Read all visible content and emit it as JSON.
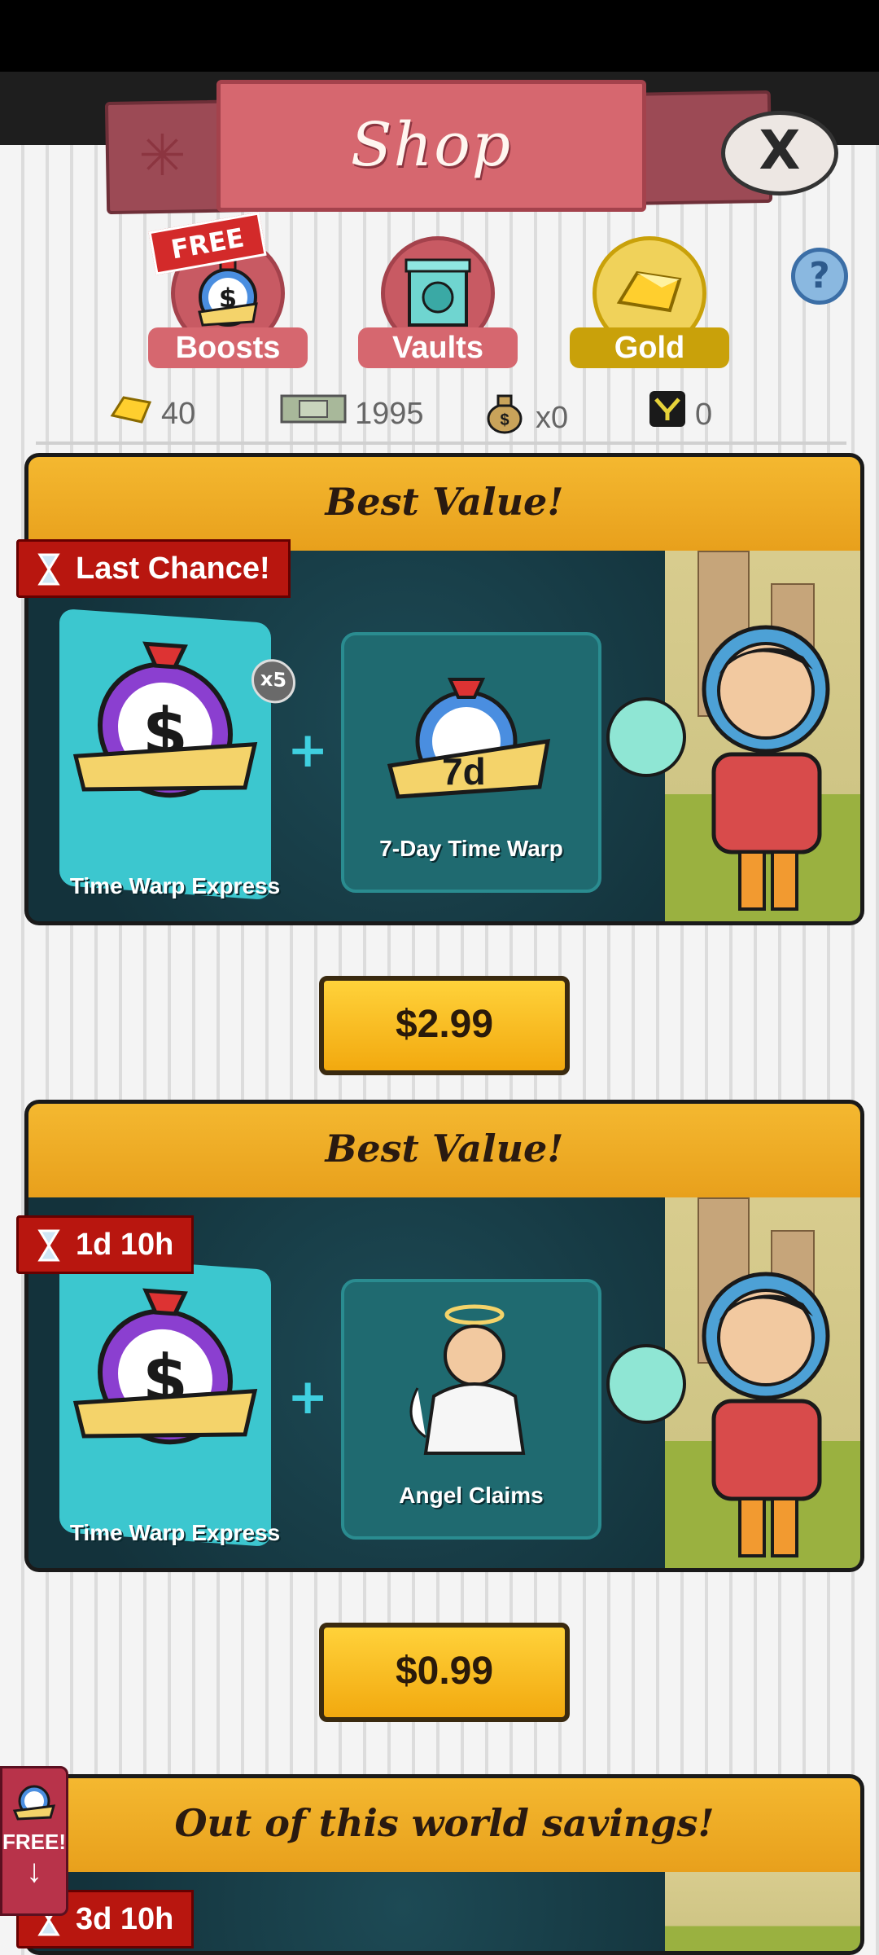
{
  "header": {
    "title": "Shop",
    "close_label": "X"
  },
  "tabs": [
    {
      "label": "Boosts",
      "badge": "FREE"
    },
    {
      "label": "Vaults"
    },
    {
      "label": "Gold",
      "selected": true
    }
  ],
  "help_label": "?",
  "currencies": {
    "gold": "40",
    "megabucks": "1995",
    "moneybag": "x0",
    "token": "0"
  },
  "offers": [
    {
      "heading": "Best Value!",
      "timer": "Last Chance!",
      "item1": {
        "label": "Time Warp Express",
        "badge": "x5"
      },
      "item2": {
        "label": "7-Day Time Warp",
        "badge": "7d"
      },
      "price": "$2.99"
    },
    {
      "heading": "Best Value!",
      "timer": "1d 10h",
      "item1": {
        "label": "Time Warp Express"
      },
      "item2": {
        "label": "Angel Claims"
      },
      "price": "$0.99"
    },
    {
      "heading": "Out of this world savings!",
      "timer": "3d 10h"
    }
  ],
  "side_free": {
    "label": "FREE!"
  },
  "colors": {
    "accent": "#f4b830",
    "tab_pink": "#d6676f",
    "tab_gold": "#c9a10a",
    "timer_red": "#b8160f"
  }
}
